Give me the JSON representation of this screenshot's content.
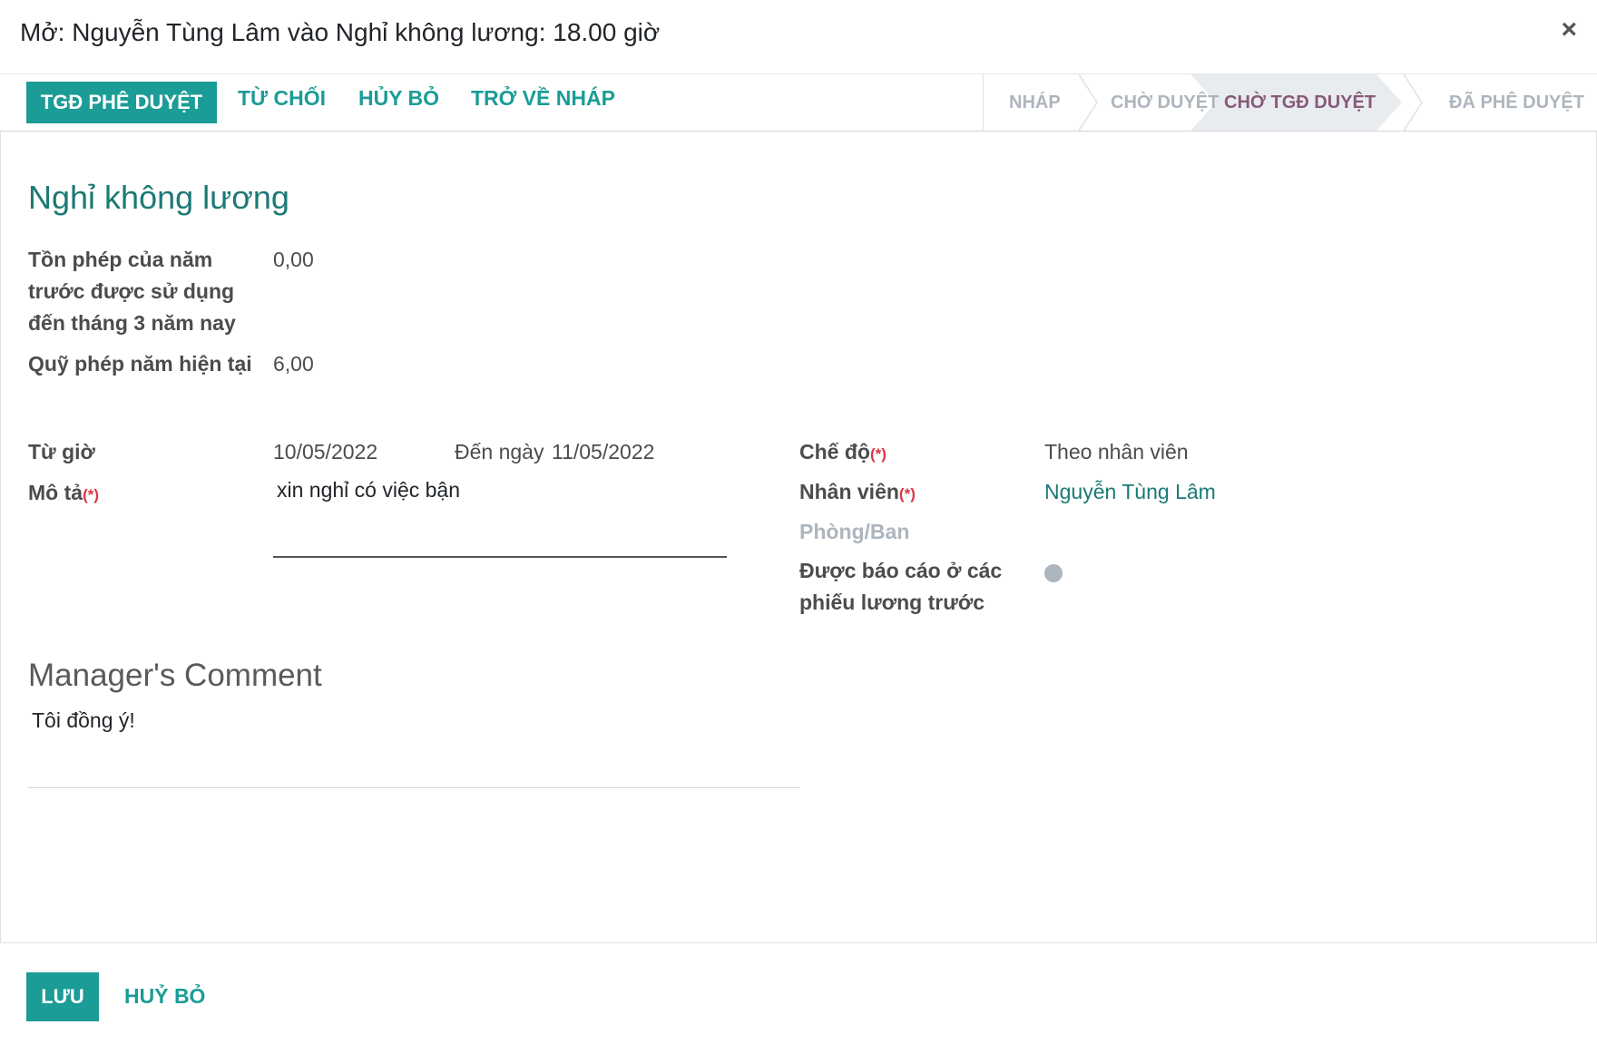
{
  "dialog": {
    "title": "Mở: Nguyễn Tùng Lâm vào Nghỉ không lương: 18.00 giờ",
    "close_symbol": "×"
  },
  "statusbar": {
    "buttons": {
      "approve": "TGĐ PHÊ DUYỆT",
      "refuse": "TỪ CHỐI",
      "cancel": "HỦY BỎ",
      "reset_draft": "TRỞ VỀ NHÁP"
    },
    "stages": [
      "NHÁP",
      "CHỜ DUYỆT",
      "CHỜ TGĐ DUYỆT",
      "ĐÃ PHÊ DUYỆT"
    ],
    "active_stage": "CHỜ TGĐ DUYỆT",
    "active_color": "#875a7b"
  },
  "form": {
    "leave_type": "Nghỉ không lương",
    "prev_year_label": "Tồn phép của năm trước được sử dụng đến tháng 3 năm nay",
    "prev_year_value": "0,00",
    "current_quota_label": "Quỹ phép năm hiện tại",
    "current_quota_value": "6,00",
    "from_label": "Từ giờ",
    "from_value": "10/05/2022",
    "to_label": "Đến ngày",
    "to_value": "11/05/2022",
    "description_label": "Mô tả",
    "description_value": "xin nghỉ có việc bận",
    "required_mark": "(*)",
    "mode_label": "Chế độ",
    "mode_value": "Theo nhân viên",
    "employee_label": "Nhân viên",
    "employee_value": "Nguyễn Tùng Lâm",
    "department_label": "Phòng/Ban",
    "reported_label": "Được báo cáo ở các phiếu lương trước"
  },
  "comment": {
    "title": "Manager's Comment",
    "value": "Tôi đồng ý!"
  },
  "footer": {
    "save": "LƯU",
    "discard": "HUỶ BỎ"
  },
  "colors": {
    "primary": "#1b9c96",
    "title": "#1b7a75",
    "required": "#dc3545"
  }
}
